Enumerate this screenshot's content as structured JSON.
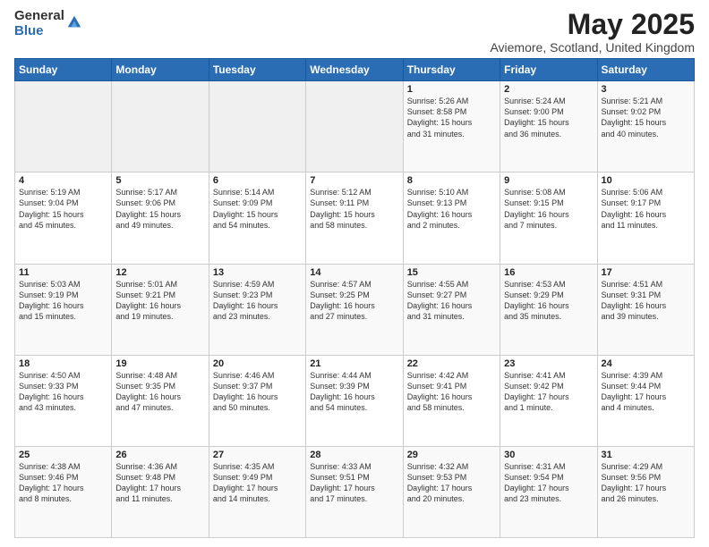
{
  "header": {
    "logo_general": "General",
    "logo_blue": "Blue",
    "month_title": "May 2025",
    "location": "Aviemore, Scotland, United Kingdom"
  },
  "days_of_week": [
    "Sunday",
    "Monday",
    "Tuesday",
    "Wednesday",
    "Thursday",
    "Friday",
    "Saturday"
  ],
  "weeks": [
    [
      {
        "day": "",
        "info": ""
      },
      {
        "day": "",
        "info": ""
      },
      {
        "day": "",
        "info": ""
      },
      {
        "day": "",
        "info": ""
      },
      {
        "day": "1",
        "info": "Sunrise: 5:26 AM\nSunset: 8:58 PM\nDaylight: 15 hours\nand 31 minutes."
      },
      {
        "day": "2",
        "info": "Sunrise: 5:24 AM\nSunset: 9:00 PM\nDaylight: 15 hours\nand 36 minutes."
      },
      {
        "day": "3",
        "info": "Sunrise: 5:21 AM\nSunset: 9:02 PM\nDaylight: 15 hours\nand 40 minutes."
      }
    ],
    [
      {
        "day": "4",
        "info": "Sunrise: 5:19 AM\nSunset: 9:04 PM\nDaylight: 15 hours\nand 45 minutes."
      },
      {
        "day": "5",
        "info": "Sunrise: 5:17 AM\nSunset: 9:06 PM\nDaylight: 15 hours\nand 49 minutes."
      },
      {
        "day": "6",
        "info": "Sunrise: 5:14 AM\nSunset: 9:09 PM\nDaylight: 15 hours\nand 54 minutes."
      },
      {
        "day": "7",
        "info": "Sunrise: 5:12 AM\nSunset: 9:11 PM\nDaylight: 15 hours\nand 58 minutes."
      },
      {
        "day": "8",
        "info": "Sunrise: 5:10 AM\nSunset: 9:13 PM\nDaylight: 16 hours\nand 2 minutes."
      },
      {
        "day": "9",
        "info": "Sunrise: 5:08 AM\nSunset: 9:15 PM\nDaylight: 16 hours\nand 7 minutes."
      },
      {
        "day": "10",
        "info": "Sunrise: 5:06 AM\nSunset: 9:17 PM\nDaylight: 16 hours\nand 11 minutes."
      }
    ],
    [
      {
        "day": "11",
        "info": "Sunrise: 5:03 AM\nSunset: 9:19 PM\nDaylight: 16 hours\nand 15 minutes."
      },
      {
        "day": "12",
        "info": "Sunrise: 5:01 AM\nSunset: 9:21 PM\nDaylight: 16 hours\nand 19 minutes."
      },
      {
        "day": "13",
        "info": "Sunrise: 4:59 AM\nSunset: 9:23 PM\nDaylight: 16 hours\nand 23 minutes."
      },
      {
        "day": "14",
        "info": "Sunrise: 4:57 AM\nSunset: 9:25 PM\nDaylight: 16 hours\nand 27 minutes."
      },
      {
        "day": "15",
        "info": "Sunrise: 4:55 AM\nSunset: 9:27 PM\nDaylight: 16 hours\nand 31 minutes."
      },
      {
        "day": "16",
        "info": "Sunrise: 4:53 AM\nSunset: 9:29 PM\nDaylight: 16 hours\nand 35 minutes."
      },
      {
        "day": "17",
        "info": "Sunrise: 4:51 AM\nSunset: 9:31 PM\nDaylight: 16 hours\nand 39 minutes."
      }
    ],
    [
      {
        "day": "18",
        "info": "Sunrise: 4:50 AM\nSunset: 9:33 PM\nDaylight: 16 hours\nand 43 minutes."
      },
      {
        "day": "19",
        "info": "Sunrise: 4:48 AM\nSunset: 9:35 PM\nDaylight: 16 hours\nand 47 minutes."
      },
      {
        "day": "20",
        "info": "Sunrise: 4:46 AM\nSunset: 9:37 PM\nDaylight: 16 hours\nand 50 minutes."
      },
      {
        "day": "21",
        "info": "Sunrise: 4:44 AM\nSunset: 9:39 PM\nDaylight: 16 hours\nand 54 minutes."
      },
      {
        "day": "22",
        "info": "Sunrise: 4:42 AM\nSunset: 9:41 PM\nDaylight: 16 hours\nand 58 minutes."
      },
      {
        "day": "23",
        "info": "Sunrise: 4:41 AM\nSunset: 9:42 PM\nDaylight: 17 hours\nand 1 minute."
      },
      {
        "day": "24",
        "info": "Sunrise: 4:39 AM\nSunset: 9:44 PM\nDaylight: 17 hours\nand 4 minutes."
      }
    ],
    [
      {
        "day": "25",
        "info": "Sunrise: 4:38 AM\nSunset: 9:46 PM\nDaylight: 17 hours\nand 8 minutes."
      },
      {
        "day": "26",
        "info": "Sunrise: 4:36 AM\nSunset: 9:48 PM\nDaylight: 17 hours\nand 11 minutes."
      },
      {
        "day": "27",
        "info": "Sunrise: 4:35 AM\nSunset: 9:49 PM\nDaylight: 17 hours\nand 14 minutes."
      },
      {
        "day": "28",
        "info": "Sunrise: 4:33 AM\nSunset: 9:51 PM\nDaylight: 17 hours\nand 17 minutes."
      },
      {
        "day": "29",
        "info": "Sunrise: 4:32 AM\nSunset: 9:53 PM\nDaylight: 17 hours\nand 20 minutes."
      },
      {
        "day": "30",
        "info": "Sunrise: 4:31 AM\nSunset: 9:54 PM\nDaylight: 17 hours\nand 23 minutes."
      },
      {
        "day": "31",
        "info": "Sunrise: 4:29 AM\nSunset: 9:56 PM\nDaylight: 17 hours\nand 26 minutes."
      }
    ]
  ]
}
